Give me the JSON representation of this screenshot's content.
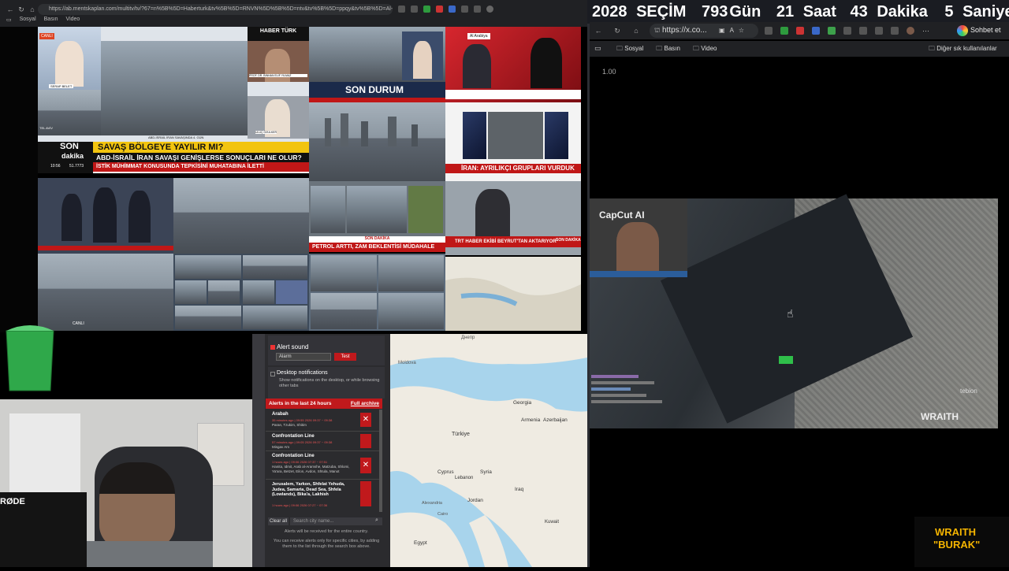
{
  "countdown": {
    "year": "2028",
    "label": "SEÇİM",
    "days": "793",
    "days_unit": "Gün",
    "hours": "21",
    "hours_unit": "Saat",
    "minutes": "43",
    "minutes_unit": "Dakika",
    "seconds": "5",
    "seconds_unit": "Saniye"
  },
  "left_browser": {
    "url": "https://ab.mentskaplan.com/multitv/tv/?67=n%5B%5D=Haberturk&tv%5B%5D=RNVN%5D%5B%5D=ntv&tv%5B%5D=ppqy&tv%5B%5D=Al-Arabiya&tv%5B",
    "bookmarks": [
      "Sosyal",
      "Basın",
      "Video"
    ]
  },
  "right_browser": {
    "url": "https://x.co...",
    "chat_button": "Sohbet et",
    "bookmarks": [
      "Sosyal",
      "Basın",
      "Video"
    ],
    "other_bookmarks": "Diğer sık kullanılanlar",
    "timestamp": "1.00",
    "capcut_label": "CapCut AI",
    "tebion_label": "tebion",
    "wraith_watermark": "WRAITH"
  },
  "tv": {
    "canli": "CANLI",
    "haberturk": "HABER TÜRK",
    "serap": "SERAP BELET",
    "binhan": "PROF. DR. BİNHAN ELİF YILMAZ",
    "uluc": "ULUÇ ÖZÜLKER",
    "tel_aviv": "TEL AVİV",
    "ticker_day": "ABD-İSRAİL İRAN SAVAŞINDA 4. GÜN",
    "son": "SON",
    "dakika": "dakika",
    "headline1": "SAVAŞ BÖLGEYE YAYILIR MI?",
    "headline2": "ABD-İSRAİL İRAN SAVAŞI GENİŞLERSE SONUÇLARI NE OLUR?",
    "headline3": "İSTİK MÜHİMMAT KONUSUNDA TEPKİSİNİ MUHATABINA İLETTİ",
    "ticker_time": "10:56",
    "ticker_value": "51.7773",
    "son_durum": "SON DURUM",
    "alarabiya": "Al Arabiya",
    "iran_banner": "İRAN: AYRILIKÇI GRUPLARI VURDUK",
    "petrol": "PETROL ARTTI, ZAM BEKLENTİSİ MÜDAHALE",
    "trt_haber": "TRT HABER EKİBİ BEYRUT'TAN AKTARIYOR",
    "son_dakika_trt": "SON DAKİKA",
    "son_dakika_tv": "SON DAKİKA"
  },
  "alerts": {
    "alert_sound_label": "Alert sound",
    "sound_option": "Alarm",
    "test_button": "Test",
    "desktop_label": "Desktop notifications",
    "desktop_hint": "Show notifications on the desktop, or while browsing other tabs",
    "last24": "Alerts in the last 24 hours",
    "full_archive": "Full archive",
    "items": [
      {
        "title": "Arabah",
        "time": "35 minutes ago | 09:55 2026 09:37 ~ 09:38",
        "places": "Paran, Tzukim, Shitim"
      },
      {
        "title": "Confrontation Line",
        "time": "57 minutes ago | 09:05 2026 09:37 ~ 09:38",
        "places": "Misgav Am"
      },
      {
        "title": "Confrontation Line",
        "time": "1 hours ago | 09:06 2026 07:37 ~ 07:51",
        "places": "Hanita, Idmit, Arab al-Aramshe, Matzuba, Shlomi, Ya'ara, Betzet, Eilon, Avdon, Shtula, Manot"
      },
      {
        "title": "Jerusalem, Yarkon, Shfelat Yehuda, Judea, Samaria, Dead Sea, Shfela (Lowlands), Bika'a, Lakhish",
        "time": "1 hours ago | 09:06 2026 07:27 ~ 07:36",
        "places": "Jerusalem - South, Jerusalem - Gate Assif"
      }
    ],
    "clear_all": "Clear all",
    "search_placeholder": "Search city name...",
    "footer1": "Alerts will be received for the entire country.",
    "footer2": "You can receive alerts only for specific cities, by adding them to the list through the search box above."
  },
  "map": {
    "labels": [
      "Днепр",
      "Moldova",
      "Georgia",
      "Armenia",
      "Azerbaijan",
      "Türkiye",
      "Cyprus",
      "Lebanon",
      "Syria",
      "Iraq",
      "Jordan",
      "Kuwait",
      "Alexandria",
      "Cairo",
      "Egypt"
    ]
  },
  "stream": {
    "rode": "RØDE",
    "wraith_line1": "WRAITH",
    "wraith_line2": "\"BURAK\""
  }
}
